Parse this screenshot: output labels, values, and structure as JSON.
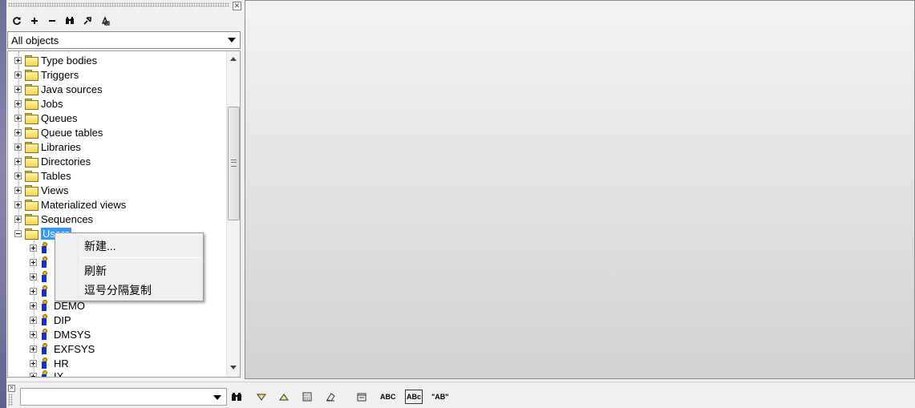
{
  "object_browser": {
    "filter": {
      "selected": "All objects"
    },
    "toolbar": {
      "refresh": "↻",
      "add": "+",
      "remove": "−",
      "find": "🔍",
      "tool1": "✎",
      "tool2": "⚙"
    },
    "tree": {
      "folders": [
        "Type bodies",
        "Triggers",
        "Java sources",
        "Jobs",
        "Queues",
        "Queue tables",
        "Libraries",
        "Directories",
        "Tables",
        "Views",
        "Materialized views",
        "Sequences"
      ],
      "selected_folder": "Users",
      "users": [
        "DEMO",
        "DIP",
        "DMSYS",
        "EXFSYS",
        "HR",
        "IX"
      ]
    }
  },
  "context_menu": {
    "new": "新建...",
    "refresh": "刷新",
    "comma_copy": "逗号分隔复制"
  },
  "findbar": {
    "input_value": "",
    "abc": "ABC",
    "abc_case": "ABc",
    "quoted": "\"AB\""
  }
}
